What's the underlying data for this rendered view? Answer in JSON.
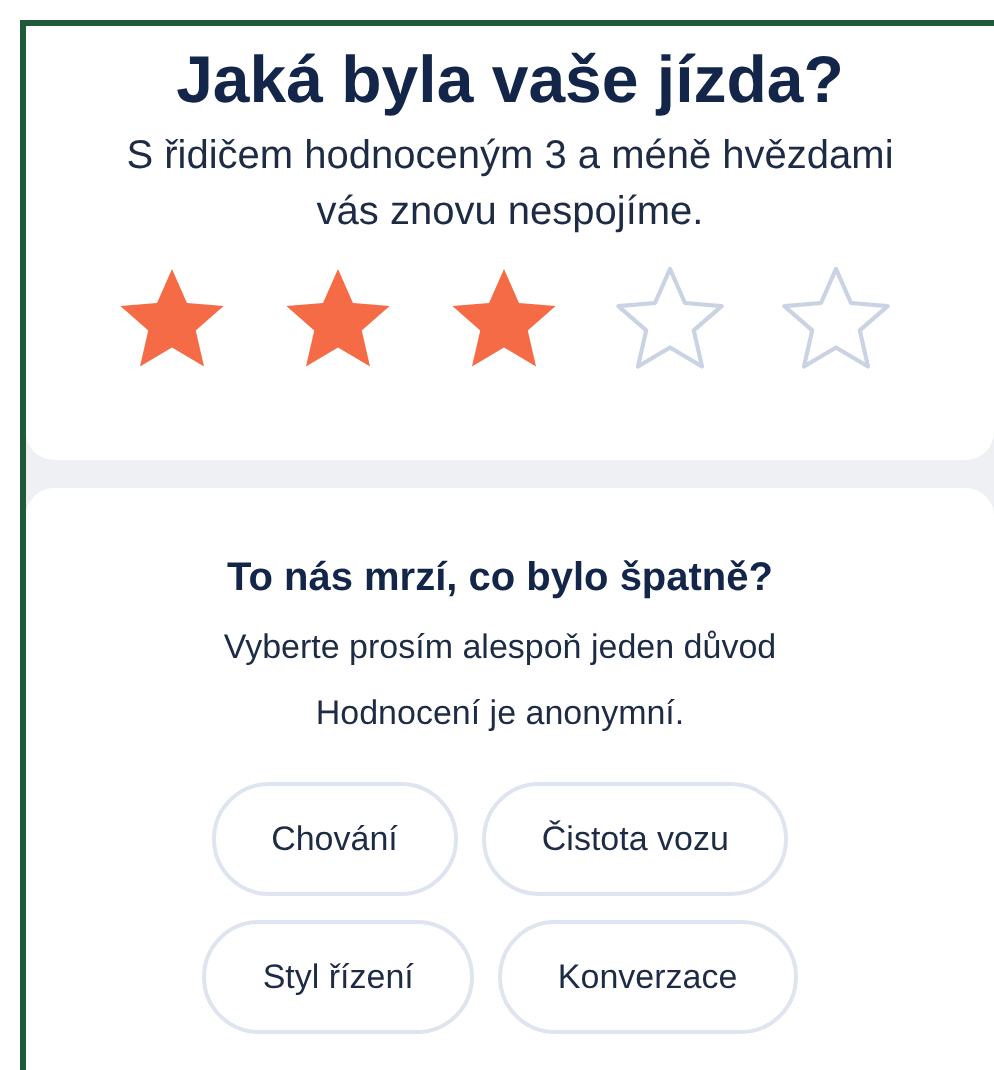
{
  "rating_card": {
    "title": "Jaká byla vaše jízda?",
    "subtitle": "S řidičem hodnoceným 3 a méně hvězdami vás znovu nespojíme.",
    "rating": {
      "stars": 3
    }
  },
  "feedback_card": {
    "title": "To nás mrzí, co bylo špatně?",
    "lines": [
      "Vyberte prosím alespoň jeden důvod",
      "Hodnocení je anonymní."
    ],
    "reasons": [
      [
        {
          "label": "Chování",
          "selected": false
        },
        {
          "label": "Čistota vozu",
          "selected": false
        }
      ],
      [
        {
          "label": "Styl řízení",
          "selected": false
        },
        {
          "label": "Konverzace",
          "selected": false
        }
      ]
    ]
  }
}
